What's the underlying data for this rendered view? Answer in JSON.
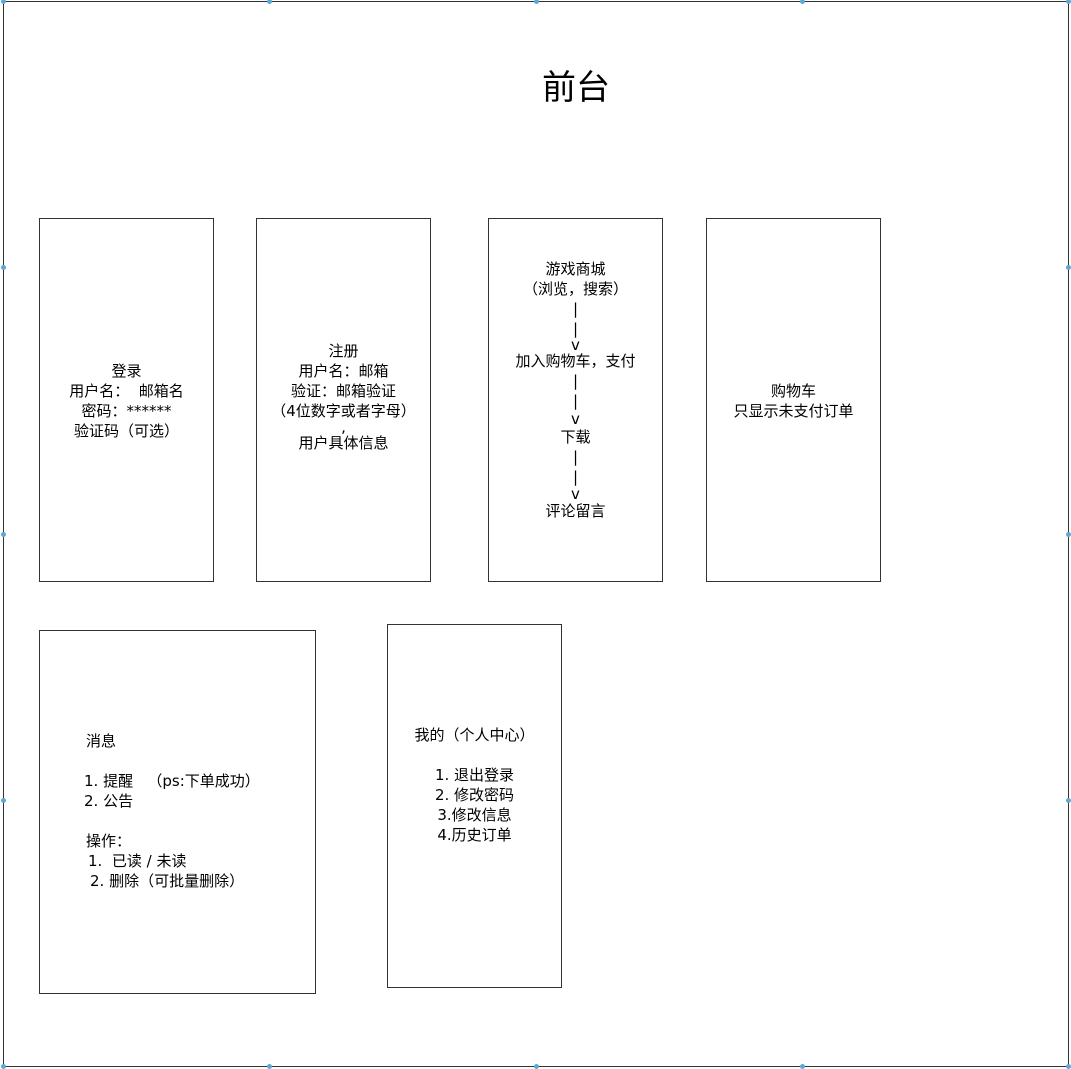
{
  "title": "前台",
  "login": {
    "lines": [
      "登录",
      "用户名：  邮箱名",
      "密码：******",
      "验证码（可选）"
    ]
  },
  "register": {
    "lines": [
      "注册",
      "用户名：邮箱",
      "验证：邮箱验证",
      "（4位数字或者字母）",
      ",",
      "用户具体信息"
    ]
  },
  "store": {
    "steps": [
      "游戏商城",
      "（浏览，搜索）",
      "加入购物车，支付",
      "下载",
      "评论留言"
    ],
    "connector": {
      "pipe": "|",
      "arrow": "v"
    }
  },
  "cart": {
    "lines": [
      "购物车",
      "只显示未支付订单"
    ]
  },
  "messages": {
    "heading": "消息",
    "items": [
      "1. 提醒   （ps:下单成功）",
      "2. 公告"
    ],
    "ops_heading": "操作：",
    "ops": [
      "1.  已读 / 未读",
      "2. 删除（可批量删除）"
    ]
  },
  "profile": {
    "heading": "我的（个人中心）",
    "items": [
      "1. 退出登录",
      "2. 修改密码",
      "3.修改信息",
      "4.历史订单"
    ]
  },
  "colors": {
    "border": "#333333",
    "handle": "#5aa9d6"
  }
}
